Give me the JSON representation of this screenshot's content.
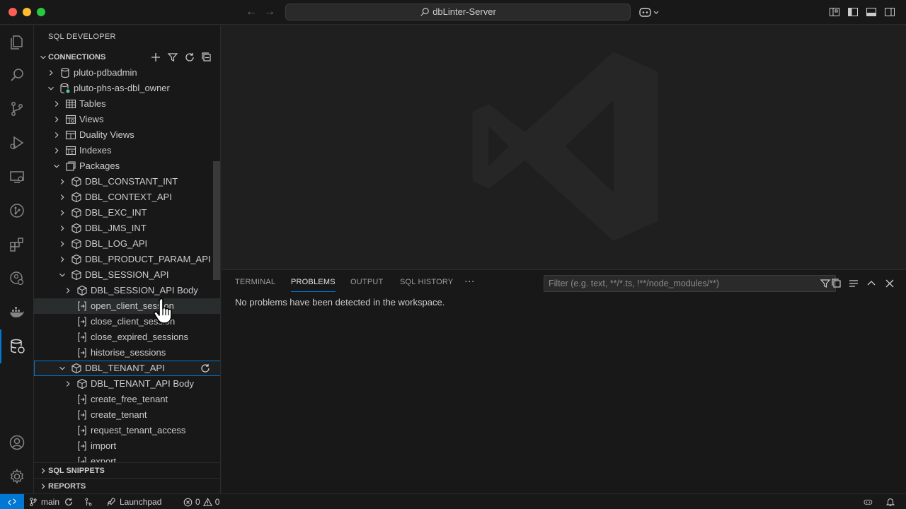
{
  "window": {
    "title": "dbLinter-Server"
  },
  "colors": {
    "accent": "#0078d4",
    "background": "#1f1f1f",
    "sidebar": "#181818",
    "text": "#cccccc"
  },
  "sidebar": {
    "title": "SQL DEVELOPER",
    "sections": {
      "connections": "CONNECTIONS",
      "snippets": "SQL SNIPPETS",
      "reports": "REPORTS"
    },
    "tree": [
      {
        "label": "pluto-pdbadmin",
        "icon": "database-icon",
        "level": 0,
        "state": "collapsed"
      },
      {
        "label": "pluto-phs-as-dbl_owner",
        "icon": "database-connected-icon",
        "level": 0,
        "state": "expanded"
      },
      {
        "label": "Tables",
        "icon": "table-icon",
        "level": 1,
        "state": "collapsed"
      },
      {
        "label": "Views",
        "icon": "view-icon",
        "level": 1,
        "state": "collapsed"
      },
      {
        "label": "Duality Views",
        "icon": "duality-view-icon",
        "level": 1,
        "state": "collapsed"
      },
      {
        "label": "Indexes",
        "icon": "index-icon",
        "level": 1,
        "state": "collapsed"
      },
      {
        "label": "Packages",
        "icon": "packages-icon",
        "level": 1,
        "state": "expanded"
      },
      {
        "label": "DBL_CONSTANT_INT",
        "icon": "package-icon",
        "level": 2,
        "state": "collapsed"
      },
      {
        "label": "DBL_CONTEXT_API",
        "icon": "package-icon",
        "level": 2,
        "state": "collapsed"
      },
      {
        "label": "DBL_EXC_INT",
        "icon": "package-icon",
        "level": 2,
        "state": "collapsed"
      },
      {
        "label": "DBL_JMS_INT",
        "icon": "package-icon",
        "level": 2,
        "state": "collapsed"
      },
      {
        "label": "DBL_LOG_API",
        "icon": "package-icon",
        "level": 2,
        "state": "collapsed"
      },
      {
        "label": "DBL_PRODUCT_PARAM_API",
        "icon": "package-icon",
        "level": 2,
        "state": "collapsed"
      },
      {
        "label": "DBL_SESSION_API",
        "icon": "package-icon",
        "level": 2,
        "state": "expanded"
      },
      {
        "label": "DBL_SESSION_API Body",
        "icon": "package-icon",
        "level": 3,
        "state": "collapsed"
      },
      {
        "label": "open_client_session",
        "icon": "procedure-icon",
        "level": 3,
        "state": "leaf",
        "hover": true
      },
      {
        "label": "close_client_session",
        "icon": "procedure-icon",
        "level": 3,
        "state": "leaf"
      },
      {
        "label": "close_expired_sessions",
        "icon": "procedure-icon",
        "level": 3,
        "state": "leaf"
      },
      {
        "label": "historise_sessions",
        "icon": "procedure-icon",
        "level": 3,
        "state": "leaf"
      },
      {
        "label": "DBL_TENANT_API",
        "icon": "package-icon",
        "level": 2,
        "state": "expanded",
        "selected": true
      },
      {
        "label": "DBL_TENANT_API Body",
        "icon": "package-icon",
        "level": 3,
        "state": "collapsed"
      },
      {
        "label": "create_free_tenant",
        "icon": "procedure-icon",
        "level": 3,
        "state": "leaf"
      },
      {
        "label": "create_tenant",
        "icon": "procedure-icon",
        "level": 3,
        "state": "leaf"
      },
      {
        "label": "request_tenant_access",
        "icon": "procedure-icon",
        "level": 3,
        "state": "leaf"
      },
      {
        "label": "import",
        "icon": "procedure-icon",
        "level": 3,
        "state": "leaf"
      },
      {
        "label": "export",
        "icon": "procedure-icon",
        "level": 3,
        "state": "leaf"
      }
    ]
  },
  "panel": {
    "tabs": [
      "TERMINAL",
      "PROBLEMS",
      "OUTPUT",
      "SQL HISTORY"
    ],
    "active_tab": "PROBLEMS",
    "more": "···",
    "filter_placeholder": "Filter (e.g. text, **/*.ts, !**/node_modules/**)",
    "message": "No problems have been detected in the workspace."
  },
  "statusbar": {
    "branch": "main",
    "launchpad": "Launchpad",
    "errors": "0",
    "warnings": "0"
  }
}
